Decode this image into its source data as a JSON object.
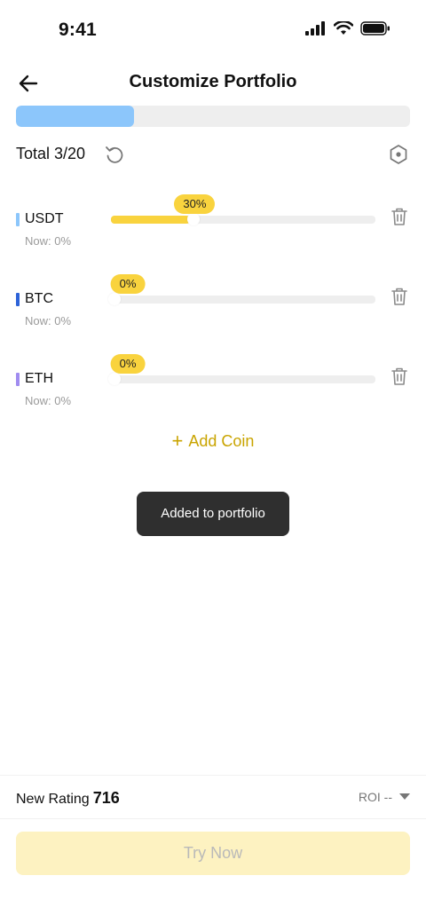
{
  "status_bar": {
    "time": "9:41",
    "icons": [
      "signal-icon",
      "wifi-icon",
      "battery-icon"
    ]
  },
  "header": {
    "title": "Customize Portfolio",
    "back_icon": "arrow-left-icon"
  },
  "portfolio_progress": {
    "fraction": 0.3
  },
  "total": {
    "label": "Total 3/20",
    "reset_icon": "refresh-icon",
    "settings_icon": "hexagon-settings-icon"
  },
  "coins": [
    {
      "name": "USDT",
      "color": "#8cc6fb",
      "percent": 30,
      "badge": "30%",
      "now": "Now: 0%"
    },
    {
      "name": "BTC",
      "color": "#2d63d8",
      "percent": 0,
      "badge": "0%",
      "now": "Now: 0%"
    },
    {
      "name": "ETH",
      "color": "#a08cf0",
      "percent": 0,
      "badge": "0%",
      "now": "Now: 0%"
    }
  ],
  "add_coin": {
    "label": "Add Coin",
    "plus": "+"
  },
  "toast": {
    "text": "Added to portfolio"
  },
  "footer": {
    "rating_label": "New Rating",
    "rating_value": "716",
    "roi_label": "ROI --",
    "try_button": "Try Now"
  },
  "colors": {
    "accent": "#f9d33e",
    "accent_text": "#c9a400",
    "progress": "#8cc6fb"
  }
}
